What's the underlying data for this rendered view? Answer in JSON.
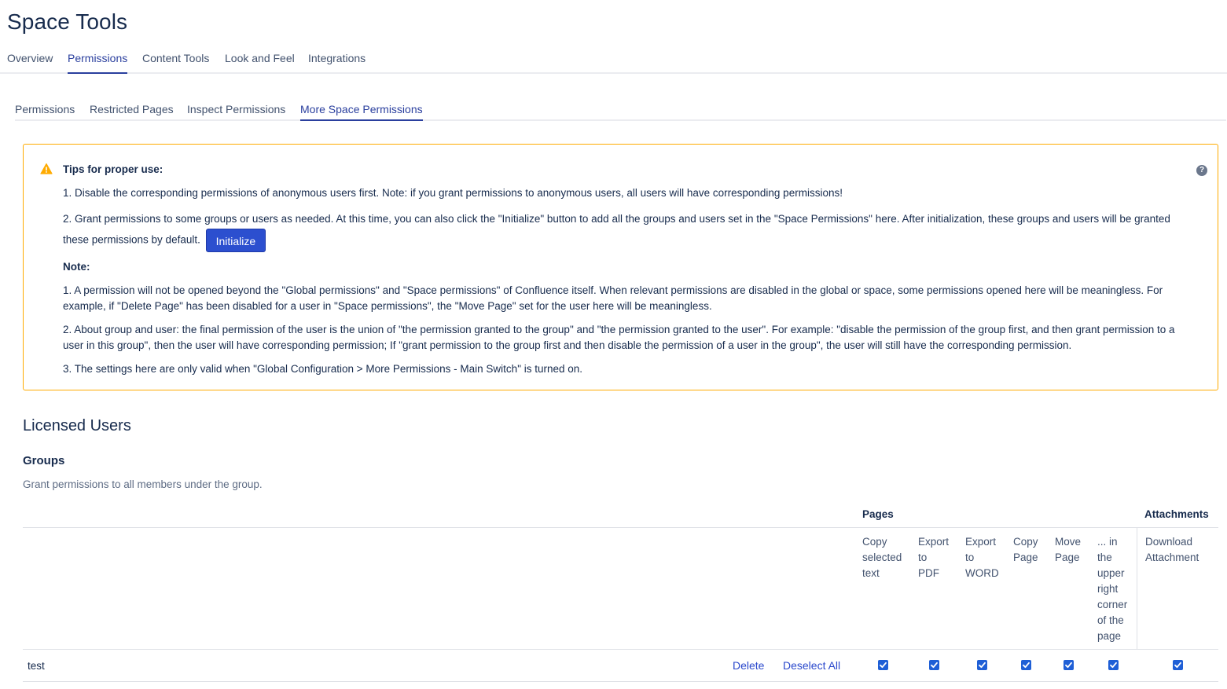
{
  "page": {
    "title": "Space Tools"
  },
  "top_tabs": [
    {
      "label": "Overview",
      "active": false
    },
    {
      "label": "Permissions",
      "active": true
    },
    {
      "label": "Content Tools",
      "active": false
    },
    {
      "label": "Look and Feel",
      "active": false
    },
    {
      "label": "Integrations",
      "active": false
    }
  ],
  "sub_tabs": [
    {
      "label": "Permissions",
      "active": false
    },
    {
      "label": "Restricted Pages",
      "active": false
    },
    {
      "label": "Inspect Permissions",
      "active": false
    },
    {
      "label": "More Space Permissions",
      "active": true
    }
  ],
  "tips": {
    "icon": "warning-icon",
    "help_icon": "question-icon",
    "heading": "Tips for proper use:",
    "items": [
      "1. Disable the corresponding permissions of anonymous users first. Note: if you grant permissions to anonymous users, all users will have corresponding permissions!",
      "2. Grant permissions to some groups or users as needed. At this time, you can also click the \"Initialize\" button to add all the groups and users set in the \"Space Permissions\" here. After initialization, these groups and users will be granted these permissions by default."
    ],
    "initialize_label": "Initialize",
    "note_heading": "Note:",
    "notes": [
      "1. A permission will not be opened beyond the \"Global permissions\" and \"Space permissions\" of Confluence itself. When relevant permissions are disabled in the global or space, some permissions opened here will be meaningless. For example, if \"Delete Page\" has been disabled for a user in \"Space permissions\", the \"Move Page\" set for the user here will be meaningless.",
      "2. About group and user: the final permission of the user is the union of \"the permission granted to the group\" and \"the permission granted to the user\". For example: \"disable the permission of the group first, and then grant permission to a user in this group\", then the user will have corresponding permission; If \"grant permission to the group first and then disable the permission of a user in the group\", the user will still have the corresponding permission.",
      "3. The settings here are only valid when \"Global Configuration > More Permissions - Main Switch\" is turned on."
    ]
  },
  "licensed_users": {
    "title": "Licensed Users",
    "groups_title": "Groups",
    "groups_description": "Grant permissions to all members under the group."
  },
  "table": {
    "column_groups": [
      "Pages",
      "Attachments"
    ],
    "columns": [
      {
        "label": "Copy selected text",
        "lines": [
          "Copy",
          "selected",
          "text"
        ]
      },
      {
        "label": "Export to PDF",
        "lines": [
          "Export",
          "to",
          "PDF"
        ]
      },
      {
        "label": "Export to WORD",
        "lines": [
          "Export",
          "to",
          "WORD"
        ]
      },
      {
        "label": "Copy Page",
        "lines": [
          "Copy",
          "Page"
        ]
      },
      {
        "label": "Move Page",
        "lines": [
          "Move",
          "Page"
        ]
      },
      {
        "label": "... in the upper right corner of the page",
        "lines": [
          "... in",
          "the",
          "upper",
          "right",
          "corner",
          "of the",
          "page"
        ]
      },
      {
        "label": "Download Attachment",
        "lines": [
          "Download",
          "Attachment"
        ]
      }
    ],
    "rows": [
      {
        "name": "test",
        "delete_label": "Delete",
        "deselect_label": "Deselect All",
        "checked": [
          true,
          true,
          true,
          true,
          true,
          true,
          true
        ]
      }
    ]
  },
  "colors": {
    "accent": "#2a3f9e",
    "button": "#2c4fcf",
    "warning_border": "#ffab00",
    "checkbox": "#1f5fd6",
    "link": "#2a48cc"
  }
}
